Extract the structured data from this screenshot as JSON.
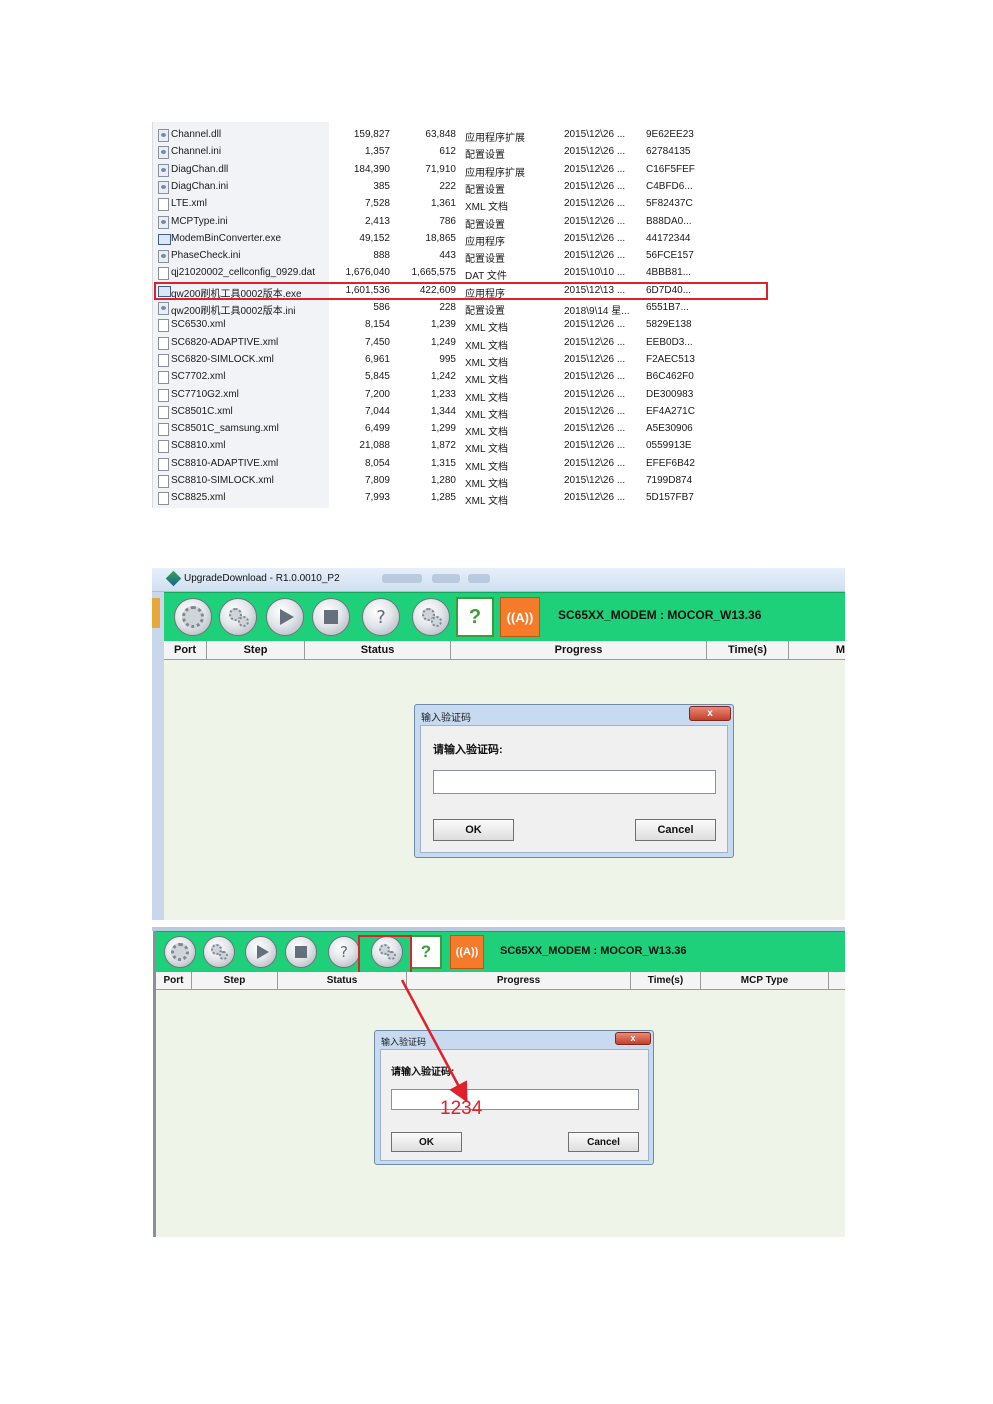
{
  "file_list": {
    "rows": [
      {
        "name": "Channel.dll",
        "size": "159,827",
        "compressed": "63,848",
        "type": "应用程序扩展",
        "date": "2015\\12\\26 ...",
        "crc": "9E62EE23",
        "icon": "dll-file-icon"
      },
      {
        "name": "Channel.ini",
        "size": "1,357",
        "compressed": "612",
        "type": "配置设置",
        "date": "2015\\12\\26 ...",
        "crc": "62784135",
        "icon": "ini-file-icon"
      },
      {
        "name": "DiagChan.dll",
        "size": "184,390",
        "compressed": "71,910",
        "type": "应用程序扩展",
        "date": "2015\\12\\26 ...",
        "crc": "C16F5FEF",
        "icon": "dll-file-icon"
      },
      {
        "name": "DiagChan.ini",
        "size": "385",
        "compressed": "222",
        "type": "配置设置",
        "date": "2015\\12\\26 ...",
        "crc": "C4BFD6...",
        "icon": "ini-file-icon"
      },
      {
        "name": "LTE.xml",
        "size": "7,528",
        "compressed": "1,361",
        "type": "XML 文档",
        "date": "2015\\12\\26 ...",
        "crc": "5F82437C",
        "icon": "xml-file-icon"
      },
      {
        "name": "MCPType.ini",
        "size": "2,413",
        "compressed": "786",
        "type": "配置设置",
        "date": "2015\\12\\26 ...",
        "crc": "B88DA0...",
        "icon": "ini-file-icon"
      },
      {
        "name": "ModemBinConverter.exe",
        "size": "49,152",
        "compressed": "18,865",
        "type": "应用程序",
        "date": "2015\\12\\26 ...",
        "crc": "44172344",
        "icon": "exe-file-icon"
      },
      {
        "name": "PhaseCheck.ini",
        "size": "888",
        "compressed": "443",
        "type": "配置设置",
        "date": "2015\\12\\26 ...",
        "crc": "56FCE157",
        "icon": "ini-file-icon"
      },
      {
        "name": "qj21020002_cellconfig_0929.dat",
        "size": "1,676,040",
        "compressed": "1,665,575",
        "type": "DAT 文件",
        "date": "2015\\10\\10 ...",
        "crc": "4BBB81...",
        "icon": "dat-file-icon"
      },
      {
        "name": "qw200刷机工具0002版本.exe",
        "size": "1,601,536",
        "compressed": "422,609",
        "type": "应用程序",
        "date": "2015\\12\\13 ...",
        "crc": "6D7D40...",
        "icon": "exe-file-icon"
      },
      {
        "name": "qw200刷机工具0002版本.ini",
        "size": "586",
        "compressed": "228",
        "type": "配置设置",
        "date": "2018\\9\\14 星...",
        "crc": "6551B7...",
        "icon": "ini-file-icon"
      },
      {
        "name": "SC6530.xml",
        "size": "8,154",
        "compressed": "1,239",
        "type": "XML 文档",
        "date": "2015\\12\\26 ...",
        "crc": "5829E138",
        "icon": "xml-file-icon"
      },
      {
        "name": "SC6820-ADAPTIVE.xml",
        "size": "7,450",
        "compressed": "1,249",
        "type": "XML 文档",
        "date": "2015\\12\\26 ...",
        "crc": "EEB0D3...",
        "icon": "xml-file-icon"
      },
      {
        "name": "SC6820-SIMLOCK.xml",
        "size": "6,961",
        "compressed": "995",
        "type": "XML 文档",
        "date": "2015\\12\\26 ...",
        "crc": "F2AEC513",
        "icon": "xml-file-icon"
      },
      {
        "name": "SC7702.xml",
        "size": "5,845",
        "compressed": "1,242",
        "type": "XML 文档",
        "date": "2015\\12\\26 ...",
        "crc": "B6C462F0",
        "icon": "xml-file-icon"
      },
      {
        "name": "SC7710G2.xml",
        "size": "7,200",
        "compressed": "1,233",
        "type": "XML 文档",
        "date": "2015\\12\\26 ...",
        "crc": "DE300983",
        "icon": "xml-file-icon"
      },
      {
        "name": "SC8501C.xml",
        "size": "7,044",
        "compressed": "1,344",
        "type": "XML 文档",
        "date": "2015\\12\\26 ...",
        "crc": "EF4A271C",
        "icon": "xml-file-icon"
      },
      {
        "name": "SC8501C_samsung.xml",
        "size": "6,499",
        "compressed": "1,299",
        "type": "XML 文档",
        "date": "2015\\12\\26 ...",
        "crc": "A5E30906",
        "icon": "xml-file-icon"
      },
      {
        "name": "SC8810.xml",
        "size": "21,088",
        "compressed": "1,872",
        "type": "XML 文档",
        "date": "2015\\12\\26 ...",
        "crc": "0559913E",
        "icon": "xml-file-icon"
      },
      {
        "name": "SC8810-ADAPTIVE.xml",
        "size": "8,054",
        "compressed": "1,315",
        "type": "XML 文档",
        "date": "2015\\12\\26 ...",
        "crc": "EFEF6B42",
        "icon": "xml-file-icon"
      },
      {
        "name": "SC8810-SIMLOCK.xml",
        "size": "7,809",
        "compressed": "1,280",
        "type": "XML 文档",
        "date": "2015\\12\\26 ...",
        "crc": "7199D874",
        "icon": "xml-file-icon"
      },
      {
        "name": "SC8825.xml",
        "size": "7,993",
        "compressed": "1,285",
        "type": "XML 文档",
        "date": "2015\\12\\26 ...",
        "crc": "5D157FB7",
        "icon": "xml-file-icon"
      }
    ],
    "highlighted_row_index": 9,
    "highlight_color": "#e0202a"
  },
  "window1": {
    "title": "UpgradeDownload - R1.0.0010_P2",
    "toolbar_title": "SC65XX_MODEM : MOCOR_W13.36",
    "toolbar_color": "#1fd07a",
    "columns": [
      "Port",
      "Step",
      "Status",
      "Progress",
      "Time(s)",
      "M"
    ],
    "dialog": {
      "title": "输入验证码",
      "close": "x",
      "prompt": "请输入验证码:",
      "input_value": "",
      "ok": "OK",
      "cancel": "Cancel"
    }
  },
  "window2": {
    "toolbar_title": "SC65XX_MODEM : MOCOR_W13.36",
    "columns": [
      "Port",
      "Step",
      "Status",
      "Progress",
      "Time(s)",
      "MCP Type"
    ],
    "dialog": {
      "title": "输入验证码",
      "close": "x",
      "prompt": "请输入验证码:",
      "input_value": "",
      "ok": "OK",
      "cancel": "Cancel"
    },
    "annotation": {
      "text": "1234",
      "color": "#e0202a"
    }
  },
  "toolbar_icons": [
    "settings-gear-icon",
    "multi-gear-icon",
    "play-icon",
    "stop-icon",
    "help-icon",
    "password-gear-icon",
    "help-square-icon",
    "antenna-icon"
  ]
}
